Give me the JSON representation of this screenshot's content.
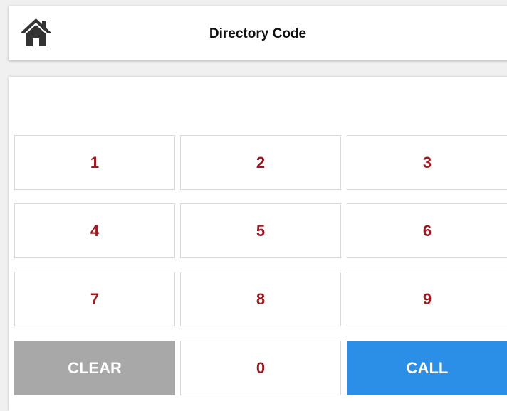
{
  "header": {
    "title": "Directory Code",
    "home_icon": "home-icon"
  },
  "code_display": {
    "value": ""
  },
  "keypad": {
    "keys": [
      "1",
      "2",
      "3",
      "4",
      "5",
      "6",
      "7",
      "8",
      "9"
    ],
    "clear_label": "CLEAR",
    "zero_label": "0",
    "call_label": "CALL"
  },
  "colors": {
    "digit_text": "#9b1b23",
    "clear_bg": "#a8a8a8",
    "call_bg": "#2b8fe8",
    "background": "#f0f0f0"
  }
}
